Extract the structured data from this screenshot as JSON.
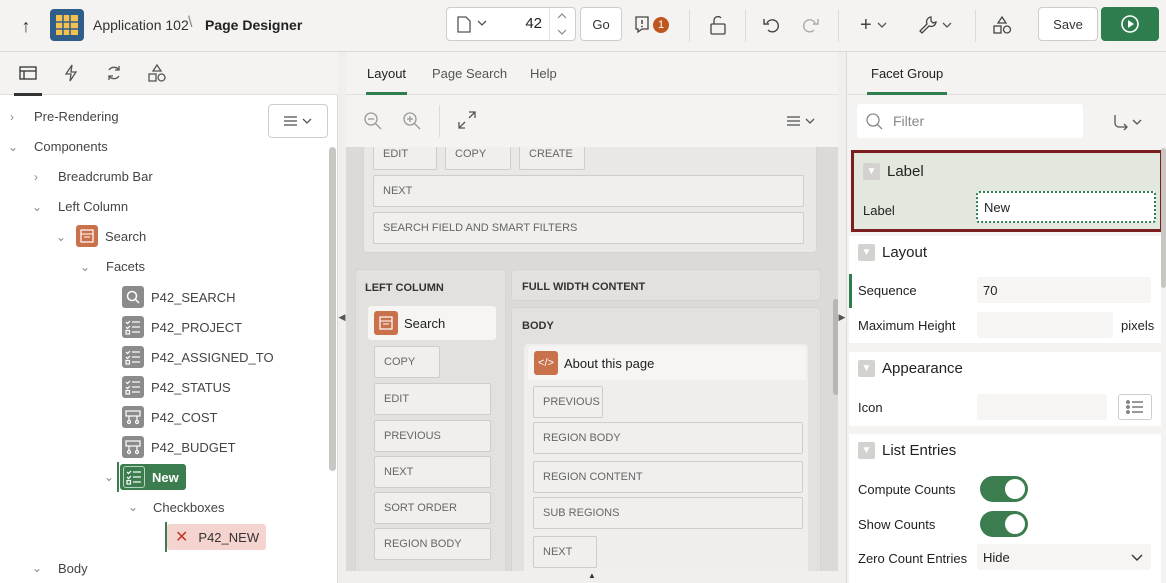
{
  "header": {
    "app_name": "Application 102",
    "separator": "\\",
    "page_designer": "Page Designer",
    "page_number": "42",
    "go_label": "Go",
    "messages_count": "1",
    "save_label": "Save"
  },
  "left": {
    "tree": [
      {
        "label": "Pre-Rendering"
      },
      {
        "label": "Components"
      },
      {
        "label": "Breadcrumb Bar"
      },
      {
        "label": "Left Column"
      },
      {
        "label": "Search"
      },
      {
        "label": "Facets"
      },
      {
        "label": "P42_SEARCH"
      },
      {
        "label": "P42_PROJECT"
      },
      {
        "label": "P42_ASSIGNED_TO"
      },
      {
        "label": "P42_STATUS"
      },
      {
        "label": "P42_COST"
      },
      {
        "label": "P42_BUDGET"
      },
      {
        "label": "New"
      },
      {
        "label": "Checkboxes"
      },
      {
        "label": "P42_NEW"
      },
      {
        "label": "Body"
      }
    ]
  },
  "center": {
    "tabs": [
      "Layout",
      "Page Search",
      "Help"
    ],
    "top_slots": [
      "EDIT",
      "COPY",
      "CREATE",
      "NEXT",
      "SEARCH FIELD AND SMART FILTERS"
    ],
    "left_column_label": "LEFT COLUMN",
    "full_width_label": "FULL WIDTH CONTENT",
    "body_label": "BODY",
    "search_region": "Search",
    "left_slots": [
      "COPY",
      "EDIT",
      "PREVIOUS",
      "NEXT",
      "SORT ORDER",
      "REGION BODY"
    ],
    "about_region": "About this page",
    "body_slots": [
      "PREVIOUS",
      "REGION BODY",
      "REGION CONTENT",
      "SUB REGIONS",
      "NEXT"
    ]
  },
  "right": {
    "tab": "Facet Group",
    "filter_placeholder": "Filter",
    "groups": {
      "label": {
        "title": "Label",
        "label_prop": "Label",
        "label_value": "New"
      },
      "layout": {
        "title": "Layout",
        "sequence_label": "Sequence",
        "sequence_value": "70",
        "maxheight_label": "Maximum Height",
        "maxheight_unit": "pixels"
      },
      "appearance": {
        "title": "Appearance",
        "icon_label": "Icon"
      },
      "list": {
        "title": "List Entries",
        "compute_counts": "Compute Counts",
        "show_counts": "Show Counts",
        "zero_count_label": "Zero Count Entries",
        "zero_count_value": "Hide"
      }
    }
  },
  "colors": {
    "accent_green": "#2e7d4f",
    "highlight_border": "#7a1e1e",
    "error_bg": "#f5d4d0"
  }
}
